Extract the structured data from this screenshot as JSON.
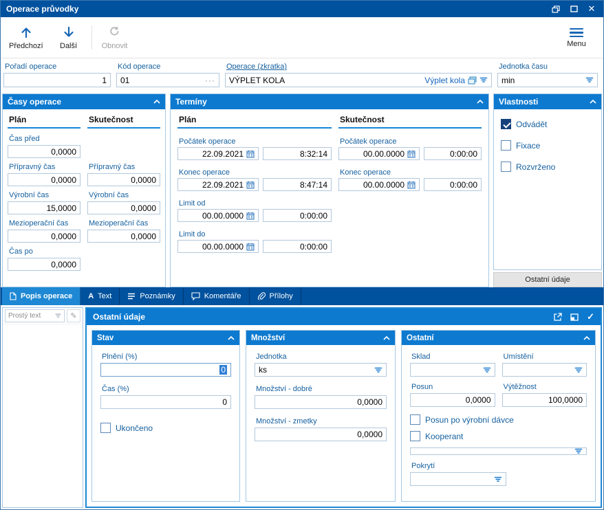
{
  "window": {
    "title": "Operace průvodky"
  },
  "icons": {
    "close": "✕",
    "ellipsis": "···",
    "pencil": "✎",
    "check": "✓",
    "letter_a": "A"
  },
  "colors": {
    "titlebar": "#00519e",
    "panel_header": "#0d7ad0",
    "accent": "#1e88d4",
    "label_blue": "#15609f",
    "selection": "#2f7fd6",
    "checked_box": "#15427c"
  },
  "toolbar": {
    "previous": "Předchozí",
    "next": "Další",
    "refresh": "Obnovit",
    "menu": "Menu"
  },
  "form": {
    "poradi": {
      "label": "Pořadí operace",
      "value": "1"
    },
    "kod": {
      "label": "Kód operace",
      "value": "01"
    },
    "operace": {
      "label": "Operace (zkratka)",
      "value": "VÝPLET KOLA",
      "link": "Výplet kola"
    },
    "jednotka": {
      "label": "Jednotka času",
      "value": "min"
    }
  },
  "casy": {
    "title": "Časy operace",
    "col_plan": "Plán",
    "col_skutecnost": "Skutečnost",
    "cas_pred": {
      "label": "Čas před",
      "value": "0,0000"
    },
    "pripravny": {
      "label": "Přípravný čas",
      "plan": "0,0000",
      "skutecnost": "0,0000"
    },
    "vyrobni": {
      "label": "Výrobní čas",
      "plan": "15,0000",
      "skutecnost": "0,0000"
    },
    "mezioperacni": {
      "label": "Mezioperační čas",
      "plan": "0,0000",
      "skutecnost": "0,0000"
    },
    "cas_po": {
      "label": "Čas po",
      "value": "0,0000"
    }
  },
  "terminy": {
    "title": "Termíny",
    "col_plan": "Plán",
    "col_skutecnost": "Skutečnost",
    "pocatek": {
      "label": "Počátek operace",
      "plan_date": "22.09.2021",
      "plan_time": "8:32:14",
      "skut_date": "00.00.0000",
      "skut_time": "0:00:00"
    },
    "konec": {
      "label": "Konec operace",
      "plan_date": "22.09.2021",
      "plan_time": "8:47:14",
      "skut_date": "00.00.0000",
      "skut_time": "0:00:00"
    },
    "limit_od": {
      "label": "Limit od",
      "date": "00.00.0000",
      "time": "0:00:00"
    },
    "limit_do": {
      "label": "Limit do",
      "date": "00.00.0000",
      "time": "0:00:00"
    }
  },
  "vlastnosti": {
    "title": "Vlastnosti",
    "odvadet": "Odvádět",
    "fixace": "Fixace",
    "rozvrzeno": "Rozvrženo",
    "ostatni_button": "Ostatní údaje"
  },
  "tabs": [
    {
      "label": "Popis operace"
    },
    {
      "label": "Text"
    },
    {
      "label": "Poznámky"
    },
    {
      "label": "Komentáře"
    },
    {
      "label": "Přílohy"
    }
  ],
  "editor": {
    "format_combo": "Prostý text"
  },
  "ostatni": {
    "title": "Ostatní údaje",
    "stav": {
      "title": "Stav",
      "plneni_label": "Plnění (%)",
      "plneni_value": "0",
      "cas_label": "Čas (%)",
      "cas_value": "0",
      "ukonceno": "Ukončeno"
    },
    "mnozstvi": {
      "title": "Množství",
      "jednotka_label": "Jednotka",
      "jednotka_value": "ks",
      "dobre_label": "Množství - dobré",
      "dobre_value": "0,0000",
      "zmetky_label": "Množství - zmetky",
      "zmetky_value": "0,0000"
    },
    "ostatni_group": {
      "title": "Ostatní",
      "sklad_label": "Sklad",
      "umisteni_label": "Umístění",
      "posun_label": "Posun",
      "posun_value": "0,0000",
      "vyteznost_label": "Výtěžnost",
      "vyteznost_value": "100,0000",
      "posun_davka": "Posun po výrobní dávce",
      "kooperant": "Kooperant",
      "pokryti_label": "Pokrytí"
    }
  }
}
